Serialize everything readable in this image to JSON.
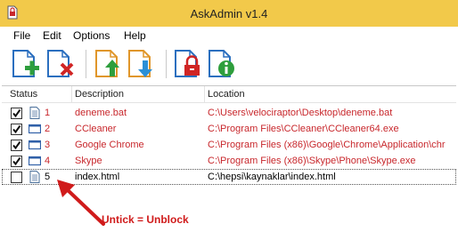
{
  "window": {
    "title": "AskAdmin v1.4"
  },
  "menu": [
    "File",
    "Edit",
    "Options",
    "Help"
  ],
  "toolbar": {
    "buttons": [
      {
        "name": "add-file-icon"
      },
      {
        "name": "remove-file-icon"
      },
      {
        "name": "move-up-icon"
      },
      {
        "name": "move-down-icon"
      },
      {
        "name": "lock-icon"
      },
      {
        "name": "info-icon"
      }
    ]
  },
  "list": {
    "columns": [
      "Status",
      "Description",
      "Location"
    ],
    "rows": [
      {
        "checked": true,
        "num": "1",
        "description": "deneme.bat",
        "location": "C:\\Users\\velociraptor\\Desktop\\deneme.bat",
        "blocked": true,
        "icon": "document-icon"
      },
      {
        "checked": true,
        "num": "2",
        "description": "CCleaner",
        "location": "C:\\Program Files\\CCleaner\\CCleaner64.exe",
        "blocked": true,
        "icon": "window-icon"
      },
      {
        "checked": true,
        "num": "3",
        "description": "Google Chrome",
        "location": "C:\\Program Files (x86)\\Google\\Chrome\\Application\\chr...",
        "blocked": true,
        "icon": "window-icon"
      },
      {
        "checked": true,
        "num": "4",
        "description": "Skype",
        "location": "C:\\Program Files (x86)\\Skype\\Phone\\Skype.exe",
        "blocked": true,
        "icon": "window-icon"
      },
      {
        "checked": false,
        "num": "5",
        "description": "index.html",
        "location": "C:\\hepsi\\kaynaklar\\index.html",
        "blocked": false,
        "icon": "document-icon"
      }
    ]
  },
  "annotation": {
    "text": "Untick = Unblock",
    "color": "#d01b1b"
  },
  "colors": {
    "titlebar": "#f2c94a",
    "blocked_text": "#c8272c"
  }
}
